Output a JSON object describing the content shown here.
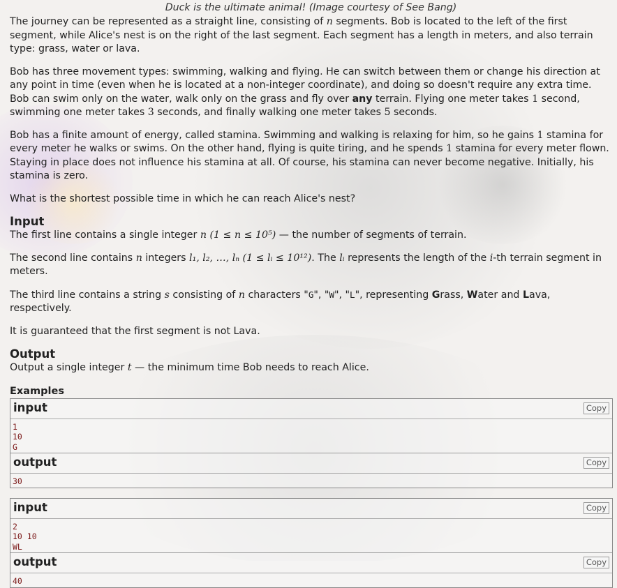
{
  "caption": "Duck is the ultimate animal! (Image courtesy of See Bang)",
  "statement": {
    "p1": {
      "a": "The journey can be represented as a straight line, consisting of ",
      "n": "n",
      "b": " segments. Bob is located to the left of the first segment, while Alice's nest is on the right of the last segment. Each segment has a length in meters, and also terrain type: grass, water or lava."
    },
    "p2": {
      "a": "Bob has three movement types: swimming, walking and flying. He can switch between them or change his direction at any point in time (even when he is located at a non-integer coordinate), and doing so doesn't require any extra time. Bob can swim only on the water, walk only on the grass and fly over ",
      "any": "any",
      "b": " terrain. Flying one meter takes ",
      "v1": "1",
      "c": " second, swimming one meter takes ",
      "v3": "3",
      "d": " seconds, and finally walking one meter takes ",
      "v5": "5",
      "e": " seconds."
    },
    "p3": {
      "a": "Bob has a finite amount of energy, called stamina. Swimming and walking is relaxing for him, so he gains ",
      "v1": "1",
      "b": " stamina for every meter he walks or swims. On the other hand, flying is quite tiring, and he spends ",
      "v2": "1",
      "c": " stamina for every meter flown. Staying in place does not influence his stamina at all. Of course, his stamina can never become negative. Initially, his stamina is zero."
    },
    "p4": "What is the shortest possible time in which he can reach Alice's nest?"
  },
  "input_section": {
    "title": "Input",
    "l1": {
      "a": "The first line contains a single integer ",
      "math": "n (1 ≤ n ≤ 10⁵)",
      "b": " — the number of segments of terrain."
    },
    "l2": {
      "a": "The second line contains ",
      "n": "n",
      "b": " integers ",
      "math": "l₁, l₂, …, lₙ (1 ≤ lᵢ ≤ 10¹²)",
      "c": ". The ",
      "li": "lᵢ",
      "d": " represents the length of the ",
      "i": "i",
      "e": "-th terrain segment in meters."
    },
    "l3": {
      "a": "The third line contains a string ",
      "s": "s",
      "b": " consisting of ",
      "n": "n",
      "c": " characters \"",
      "g": "G",
      "d": "\", \"",
      "w": "W",
      "e": "\", \"",
      "l": "L",
      "f": "\", representing ",
      "G": "G",
      "rass": "rass, ",
      "W": "W",
      "ater": "ater and ",
      "L": "L",
      "ava": "ava, respectively."
    },
    "l4": "It is guaranteed that the first segment is not Lava."
  },
  "output_section": {
    "title": "Output",
    "a": "Output a single integer ",
    "t": "t",
    "b": " — the minimum time Bob needs to reach Alice."
  },
  "examples": {
    "title": "Examples",
    "copy_label": "Copy",
    "input_label": "input",
    "output_label": "output",
    "items": [
      {
        "input": [
          "1",
          "10",
          "G"
        ],
        "output": [
          "30"
        ]
      },
      {
        "input": [
          "2",
          "10 10",
          "WL"
        ],
        "output": [
          "40"
        ]
      }
    ]
  }
}
